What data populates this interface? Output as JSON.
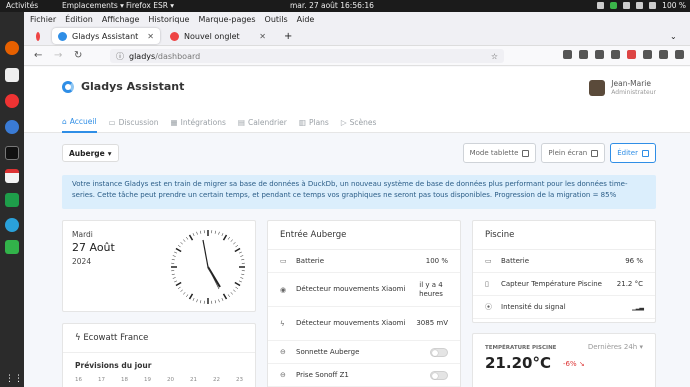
{
  "os": {
    "activities": "Activités",
    "places": "Emplacements ▾",
    "app_menu": "Firefox ESR ▾",
    "clock": "mar. 27 août  16:56:16",
    "battery": "100 %"
  },
  "browser": {
    "menu": [
      "Fichier",
      "Édition",
      "Affichage",
      "Historique",
      "Marque-pages",
      "Outils",
      "Aide"
    ],
    "tabs": [
      {
        "label": "Gladys Assistant",
        "active": true
      },
      {
        "label": "Nouvel onglet",
        "active": false
      }
    ],
    "new_tab": "+",
    "url_host": "gladys",
    "url_path": "/dashboard"
  },
  "app": {
    "brand": "Gladys Assistant",
    "user": {
      "name": "Jean-Marie",
      "role": "Administrateur"
    },
    "nav": [
      "Accueil",
      "Discussion",
      "Intégrations",
      "Calendrier",
      "Plans",
      "Scènes"
    ],
    "house_select": "Auberge",
    "buttons": {
      "tablet": "Mode tablette",
      "fullscreen": "Plein écran",
      "edit": "Éditer"
    },
    "alert": "Votre instance Gladys est en train de migrer sa base de données à DuckDb, un nouveau système de base de données plus performant pour les données time-series. Cette tâche peut prendre un certain temps, et pendant ce temps vos graphiques ne seront pas tous disponibles. Progression de la migration = 85%",
    "clock_card": {
      "day": "Mardi",
      "date": "27 Août",
      "year": "2024"
    },
    "ecowatt": {
      "title": "Ecowatt France",
      "subtitle": "Prévisions du jour",
      "hours": [
        "16",
        "17",
        "18",
        "19",
        "20",
        "21",
        "22",
        "23"
      ]
    },
    "entree": {
      "title": "Entrée Auberge",
      "rows": [
        {
          "label": "Batterie",
          "value": "100 %"
        },
        {
          "label": "Détecteur mouvements Xiaomi",
          "value": "il y a 4 heures"
        },
        {
          "label": "Détecteur mouvements Xiaomi",
          "value": "3085 mV"
        },
        {
          "label": "Sonnette Auberge",
          "value": ""
        },
        {
          "label": "Prise Sonoff Z1",
          "value": ""
        }
      ]
    },
    "piscine": {
      "title": "Piscine",
      "rows": [
        {
          "label": "Batterie",
          "value": "96 %"
        },
        {
          "label": "Capteur Température Piscine",
          "value": "21.2 °C"
        },
        {
          "label": "Intensité du signal",
          "value": ""
        }
      ]
    },
    "temp_card": {
      "label": "TEMPÉRATURE PISCINE",
      "value": "21.20°C",
      "delta": "-6%",
      "period": "Dernières 24h"
    }
  }
}
